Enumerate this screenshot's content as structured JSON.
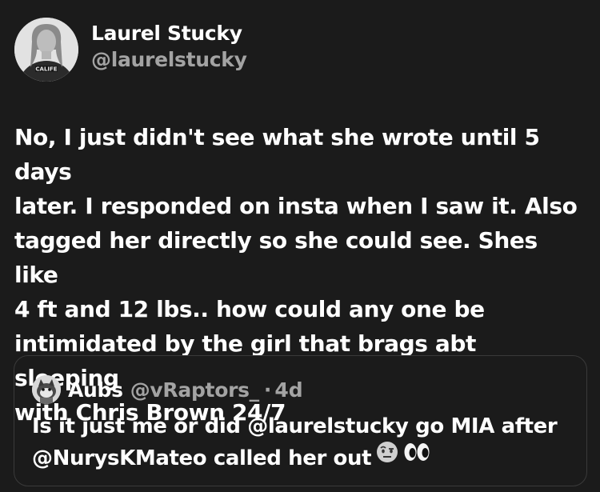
{
  "author": {
    "display_name": "Laurel Stucky",
    "handle": "@laurelstucky",
    "avatar_text": "CALIFE"
  },
  "tweet": {
    "text": "No, I just didn't see what she wrote until 5 days\nlater. I responded on insta when I saw it. Also\ntagged her directly so she could see. Shes like\n4 ft and 12 lbs.. how could any one be\nintimidated by the girl that brags abt sleeping\nwith Chris Brown 24/7"
  },
  "quote": {
    "display_name": "Aubs",
    "handle": "@vRaptors_",
    "separator": "·",
    "time": "4d",
    "text": "Is it just me or did @laurelstucky go MIA after @NurysKMateo called her out",
    "emojis": [
      "face-with-raised-eyebrow",
      "eyes"
    ]
  },
  "colors": {
    "background": "#1b1b1b",
    "text_primary": "#ffffff",
    "text_secondary": "#a3a3a3",
    "border": "#3a3a3a"
  }
}
